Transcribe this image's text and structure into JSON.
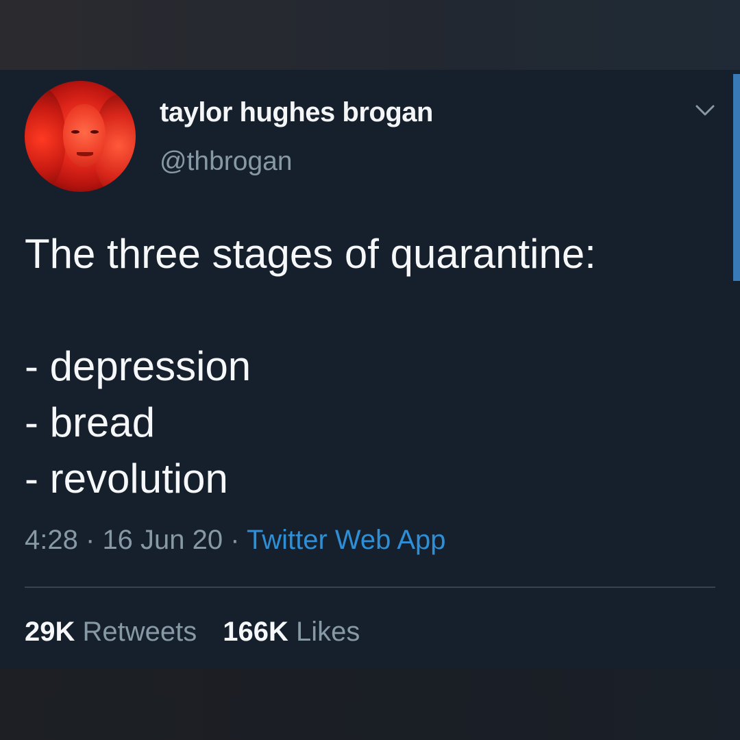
{
  "author": {
    "display_name": "taylor hughes brogan",
    "handle": "@thbrogan"
  },
  "tweet": {
    "lines": [
      "The three stages of quarantine:",
      "- depression",
      "- bread",
      "- revolution"
    ]
  },
  "meta": {
    "time": "4:28",
    "separator": "·",
    "date": "16 Jun 20",
    "source": "Twitter Web App"
  },
  "stats": {
    "retweets_count": "29K",
    "retweets_label": "Retweets",
    "likes_count": "166K",
    "likes_label": "Likes"
  },
  "icons": {
    "menu": "chevron-down-icon"
  },
  "colors": {
    "background": "#16202c",
    "accent": "#2f8fd6",
    "secondary_text": "#8899a6",
    "primary_text": "#f5f7f9"
  }
}
